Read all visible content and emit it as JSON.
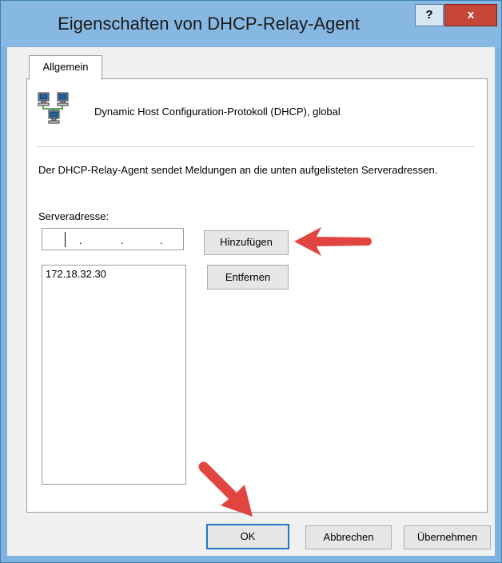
{
  "window": {
    "title": "Eigenschaften von DHCP-Relay-Agent",
    "help_label": "?",
    "close_label": "x"
  },
  "tabs": [
    {
      "label": "Allgemein",
      "active": true
    }
  ],
  "general": {
    "global_label": "Dynamic Host Configuration-Protokoll (DHCP), global",
    "description": "Der DHCP-Relay-Agent sendet Meldungen an die unten aufgelisteten Serveradressen.",
    "server_address_label": "Serveradresse:",
    "ip_input_value": ""
  },
  "buttons": {
    "add": "Hinzufügen",
    "remove": "Entfernen",
    "ok": "OK",
    "cancel": "Abbrechen",
    "apply": "Übernehmen"
  },
  "server_list": [
    "172.18.32.30"
  ],
  "icons": {
    "network": "network-computers-icon",
    "arrow": "red-pointer-arrow-icon"
  },
  "colors": {
    "title_bar": "#87b8e2",
    "close_button": "#c7463a",
    "arrow": "#e0463f",
    "default_button_border": "#1e76c8"
  }
}
